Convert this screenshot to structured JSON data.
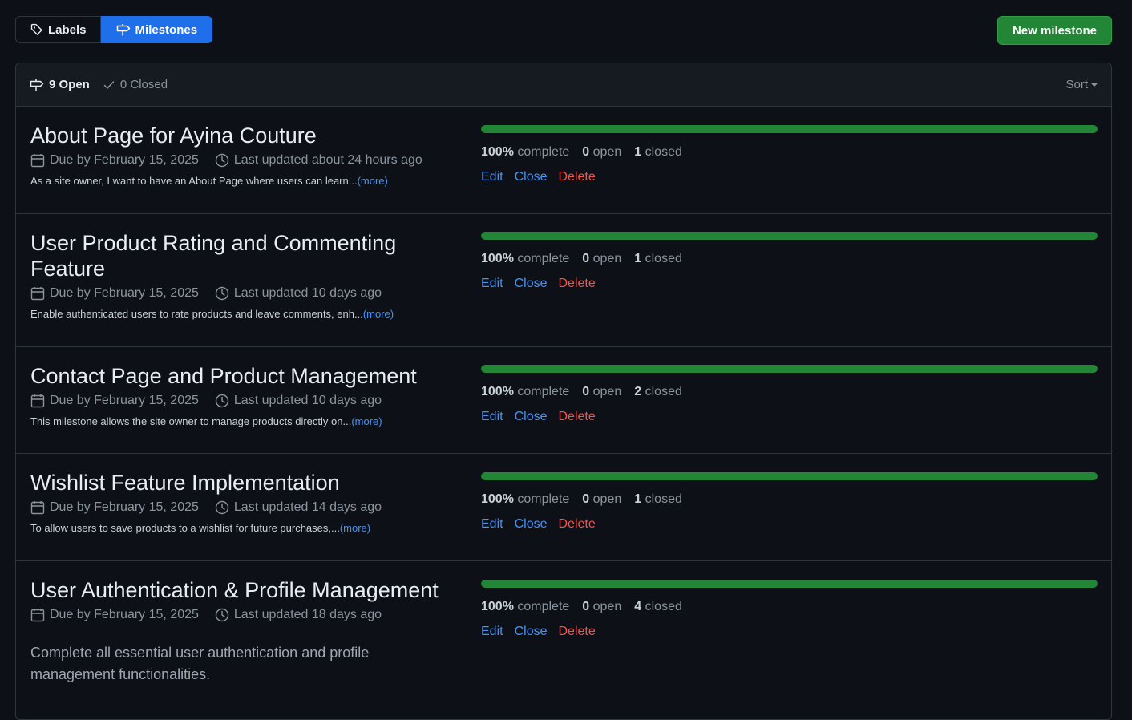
{
  "tabs": {
    "labels": "Labels",
    "milestones": "Milestones"
  },
  "new_milestone": "New milestone",
  "filter": {
    "open": "9 Open",
    "closed": "0 Closed",
    "sort": "Sort"
  },
  "actions": {
    "edit": "Edit",
    "close": "Close",
    "delete": "Delete",
    "more": "(more)"
  },
  "colors": {
    "accent": "#1f6feb",
    "success": "#238636",
    "danger": "#f85149",
    "link": "#4493f8"
  },
  "milestones": [
    {
      "title": "About Page for Ayina Couture",
      "due": "Due by February 15, 2025",
      "updated": "Last updated about 24 hours ago",
      "description": "As a site owner, I want to have an About Page where users can learn...",
      "percent": "100%",
      "percent_label": "complete",
      "open_count": "0",
      "open_label": "open",
      "closed_count": "1",
      "closed_label": "closed",
      "progress": 1.0
    },
    {
      "title": "User Product Rating and Commenting Feature",
      "due": "Due by February 15, 2025",
      "updated": "Last updated 10 days ago",
      "description": "Enable authenticated users to rate products and leave comments, enh...",
      "percent": "100%",
      "percent_label": "complete",
      "open_count": "0",
      "open_label": "open",
      "closed_count": "1",
      "closed_label": "closed",
      "progress": 1.0
    },
    {
      "title": "Contact Page and Product Management",
      "due": "Due by February 15, 2025",
      "updated": "Last updated 10 days ago",
      "description": "This milestone allows the site owner to manage products directly on...",
      "percent": "100%",
      "percent_label": "complete",
      "open_count": "0",
      "open_label": "open",
      "closed_count": "2",
      "closed_label": "closed",
      "progress": 1.0
    },
    {
      "title": "Wishlist Feature Implementation",
      "due": "Due by February 15, 2025",
      "updated": "Last updated 14 days ago",
      "description": "To allow users to save products to a wishlist for future purchases,...",
      "percent": "100%",
      "percent_label": "complete",
      "open_count": "0",
      "open_label": "open",
      "closed_count": "1",
      "closed_label": "closed",
      "progress": 1.0
    },
    {
      "title": "User Authentication & Profile Management",
      "due": "Due by February 15, 2025",
      "updated": "Last updated 18 days ago",
      "description": "Complete all essential user authentication and profile management functionalities.",
      "percent": "100%",
      "percent_label": "complete",
      "open_count": "0",
      "open_label": "open",
      "closed_count": "4",
      "closed_label": "closed",
      "progress": 1.0
    }
  ]
}
